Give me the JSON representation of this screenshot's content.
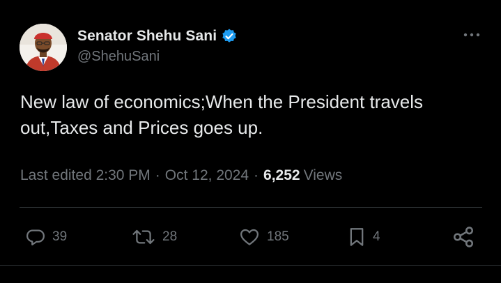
{
  "author": {
    "display_name": "Senator Shehu Sani",
    "handle": "@ShehuSani",
    "verified": true
  },
  "tweet": {
    "text": "New law of economics;When the President travels out,Taxes and Prices goes up."
  },
  "meta": {
    "edited_label": "Last edited 2:30 PM",
    "separator": "·",
    "date": "Oct 12, 2024",
    "views_count": "6,252",
    "views_label": "Views"
  },
  "actions": {
    "replies": "39",
    "reposts": "28",
    "likes": "185",
    "bookmarks": "4"
  },
  "icons": {
    "more": "more-horizontal-icon",
    "verified": "verified-badge-icon",
    "reply": "reply-icon",
    "repost": "repost-icon",
    "like": "heart-icon",
    "bookmark": "bookmark-icon",
    "share": "share-icon"
  },
  "colors": {
    "background": "#000000",
    "primary_text": "#e7e9ea",
    "secondary_text": "#71767b",
    "verified_blue": "#1d9bf0",
    "divider": "#2f3336"
  }
}
